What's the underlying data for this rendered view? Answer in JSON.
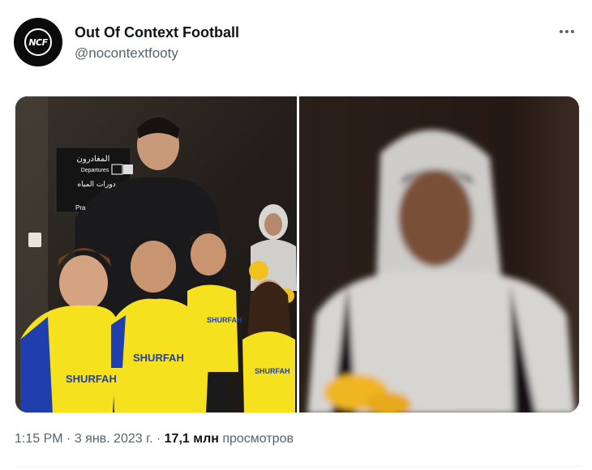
{
  "author": {
    "avatar_text": "NCF",
    "display_name": "Out Of Context Football",
    "handle": "@nocontextfooty",
    "more_icon": "more-dots-icon"
  },
  "media": {
    "left_sign": {
      "arabic_top": "المغادرون",
      "departures": "Departures",
      "arabic_bottom": "دورات المياه",
      "partial": "Pra"
    },
    "jersey_text": "SHURFAH"
  },
  "meta": {
    "time": "1:15 PM",
    "separator": " · ",
    "date": "3 янв. 2023 г.",
    "views_count": "17,1 млн",
    "views_label": " просмотров"
  },
  "colors": {
    "text_primary": "#0f1419",
    "text_secondary": "#536471",
    "jersey_yellow": "#f5e11e",
    "jersey_blue": "#1f3fae"
  }
}
